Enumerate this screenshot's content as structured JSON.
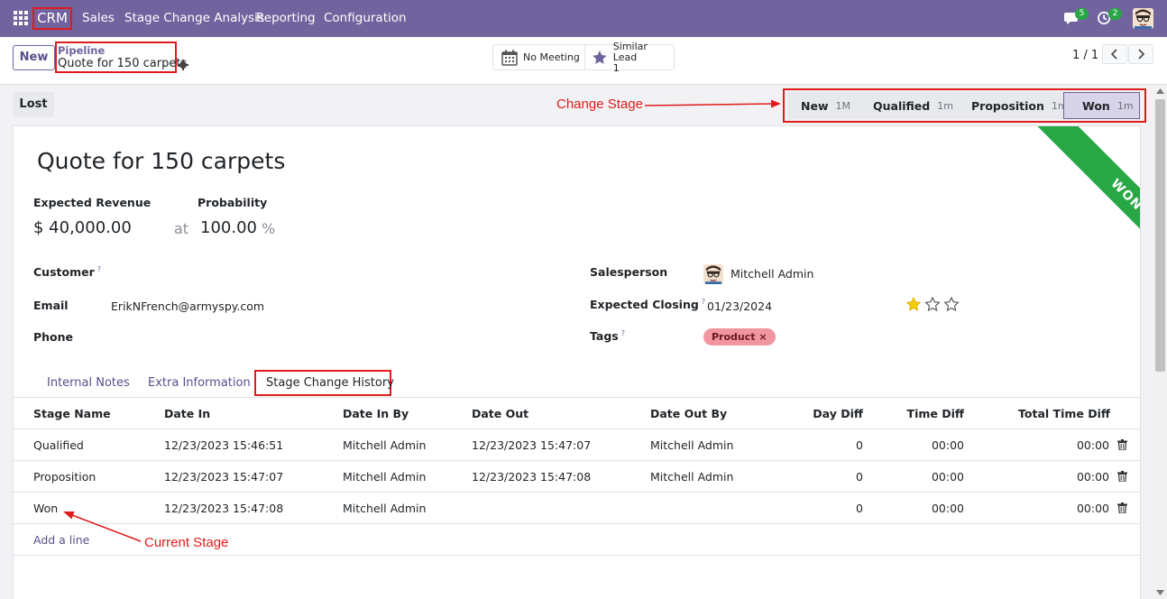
{
  "navbar": {
    "brand": "CRM",
    "menu": [
      "Sales",
      "Stage Change Analysis",
      "Reporting",
      "Configuration"
    ],
    "messages_count": "5",
    "activities_count": "2"
  },
  "control": {
    "new_label": "New",
    "breadcrumb_parent": "Pipeline",
    "breadcrumb_current": "Quote for 150 carpets",
    "meeting_label": "No Meeting",
    "similar_label": "Similar Lead",
    "similar_count": "1",
    "pager": "1 / 1"
  },
  "statusbar": {
    "lost_label": "Lost",
    "annotation": "Change Stage",
    "stages": [
      {
        "name": "New",
        "duration": "1M"
      },
      {
        "name": "Qualified",
        "duration": "1m"
      },
      {
        "name": "Proposition",
        "duration": "1m"
      },
      {
        "name": "Won",
        "duration": "1m"
      }
    ],
    "active_stage": "Won"
  },
  "form": {
    "ribbon": "WON",
    "title": "Quote for 150 carpets",
    "expected_revenue_label": "Expected Revenue",
    "expected_revenue": "$ 40,000.00",
    "at_label": "at",
    "probability_label": "Probability",
    "probability": "100.00",
    "percent": "%",
    "customer_label": "Customer",
    "email_label": "Email",
    "email": "ErikNFrench@armyspy.com",
    "phone_label": "Phone",
    "salesperson_label": "Salesperson",
    "salesperson": "Mitchell Admin",
    "closing_label": "Expected Closing",
    "closing": "01/23/2024",
    "tags_label": "Tags",
    "tag": "Product",
    "priority_stars": 1,
    "help_mark": "?",
    "tag_remove": "×"
  },
  "tabs": [
    "Internal Notes",
    "Extra Information",
    "Stage Change History"
  ],
  "history": {
    "columns": [
      "Stage Name",
      "Date In",
      "Date In By",
      "Date Out",
      "Date Out By",
      "Day Diff",
      "Time Diff",
      "Total Time Diff"
    ],
    "rows": [
      [
        "Qualified",
        "12/23/2023 15:46:51",
        "Mitchell Admin",
        "12/23/2023 15:47:07",
        "Mitchell Admin",
        "0",
        "00:00",
        "00:00"
      ],
      [
        "Proposition",
        "12/23/2023 15:47:07",
        "Mitchell Admin",
        "12/23/2023 15:47:08",
        "Mitchell Admin",
        "0",
        "00:00",
        "00:00"
      ],
      [
        "Won",
        "12/23/2023 15:47:08",
        "Mitchell Admin",
        "",
        "",
        "0",
        "00:00",
        "00:00"
      ]
    ],
    "add_line": "Add a line",
    "current_annotation": "Current Stage"
  },
  "colors": {
    "navbar": "#71639e",
    "annotation": "#e01b1b",
    "ribbon": "#28a745",
    "tag": "#f1959f"
  }
}
